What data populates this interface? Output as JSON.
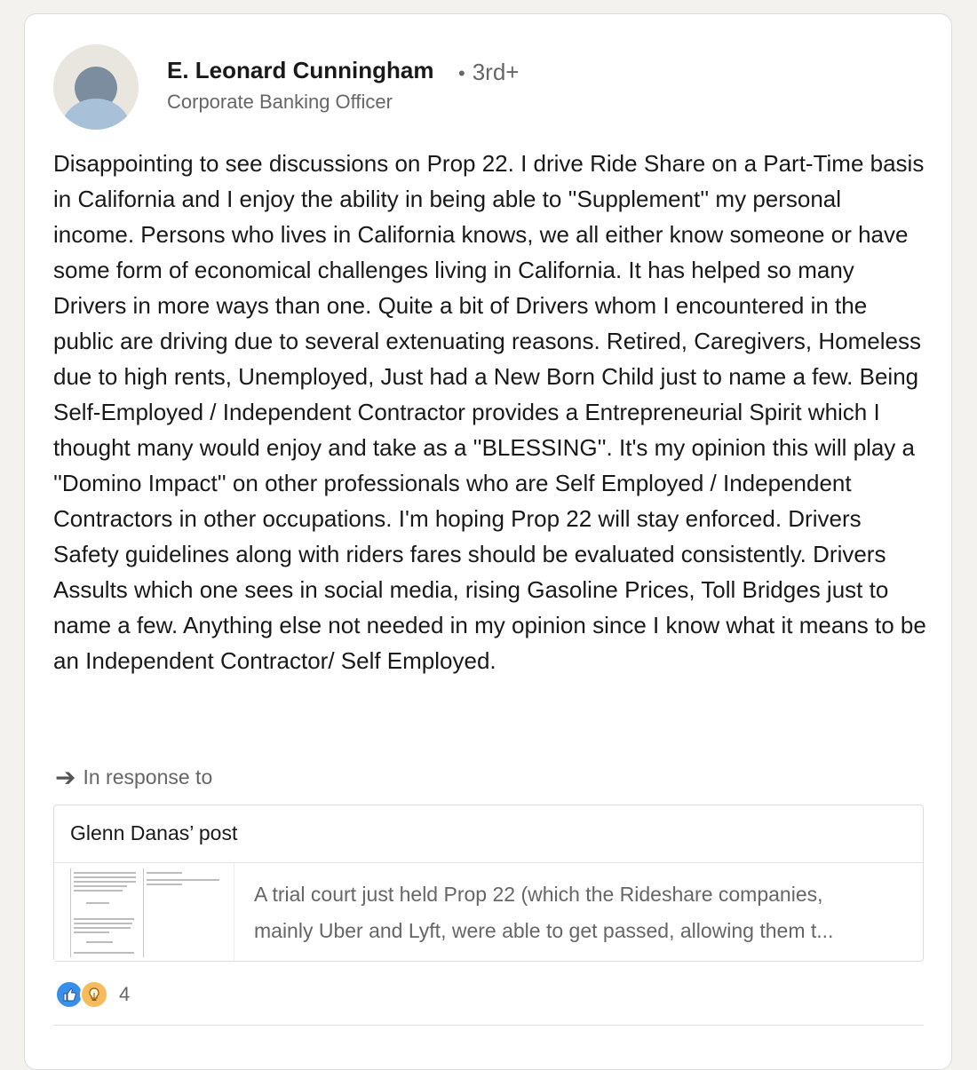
{
  "comment": {
    "author": {
      "name": "E. Leonard Cunningham",
      "separator": "•",
      "degree": "3rd+",
      "headline": "Corporate Banking Officer"
    },
    "text": "Disappointing to see discussions on Prop 22. I drive Ride Share on a Part-Time basis in California and I enjoy the ability in being able to ''Supplement'' my personal income. Persons who lives in California knows, we all either know someone or have some form of economical challenges living in California. It has helped so many Drivers in more ways than one. Quite a bit of Drivers whom I encountered in the public are driving due to several extenuating reasons. Retired, Caregivers, Homeless due to high rents, Unemployed, Just had a New Born Child just to name a few. Being Self-Employed / Independent Contractor provides a Entrepreneurial Spirit which I thought many would enjoy and take as a ''BLESSING''. It's my opinion this will play a ''Domino Impact'' on other professionals who are Self Employed / Independent Contractors in other occupations. I'm hoping Prop 22 will stay enforced. Drivers Safety guidelines along with riders fares should be evaluated consistently. Drivers Assults which one sees in social media, rising Gasoline Prices, Toll Bridges just to name a few. Anything else not needed in my opinion since I know what it means to be an Independent Contractor/ Self Employed.",
    "in_response_label": "In response to",
    "referenced_post": {
      "title": "Glenn Danas’ post",
      "snippet_line1": "A trial court just held Prop 22 (which the Rideshare companies,",
      "snippet_line2": "mainly Uber and Lyft, were able to get passed, allowing them t..."
    },
    "reactions": {
      "icons": [
        "like-icon",
        "insightful-icon"
      ],
      "count": "4"
    }
  },
  "colors": {
    "like": "#378fe9",
    "insightful": "#f5bb5c",
    "muted_text": "#666666"
  }
}
